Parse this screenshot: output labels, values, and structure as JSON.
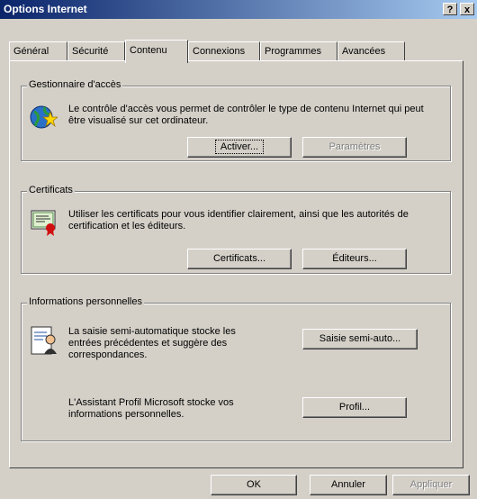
{
  "window": {
    "title": "Options Internet",
    "help_glyph": "?",
    "close_glyph": "x"
  },
  "tabs": [
    {
      "label": "Général"
    },
    {
      "label": "Sécurité"
    },
    {
      "label": "Contenu"
    },
    {
      "label": "Connexions"
    },
    {
      "label": "Programmes"
    },
    {
      "label": "Avancées"
    }
  ],
  "access": {
    "legend": "Gestionnaire d'accès",
    "description": "Le contrôle d'accès vous permet de contrôler le type de contenu Internet qui peut être visualisé sur cet ordinateur.",
    "enable_button": "Activer...",
    "settings_button": "Paramètres"
  },
  "certificates": {
    "legend": "Certificats",
    "description": "Utiliser les certificats pour vous identifier clairement, ainsi que les autorités de certification et les éditeurs.",
    "certificates_button": "Certificats...",
    "publishers_button": "Éditeurs..."
  },
  "personal": {
    "legend": "Informations personnelles",
    "autocomplete_text": "La saisie semi-automatique stocke les entrées précédentes et suggère des correspondances.",
    "autocomplete_button": "Saisie semi-auto...",
    "profile_text": "L'Assistant Profil Microsoft stocke vos informations personnelles.",
    "profile_button": "Profil..."
  },
  "footer": {
    "ok": "OK",
    "cancel": "Annuler",
    "apply": "Appliquer"
  }
}
